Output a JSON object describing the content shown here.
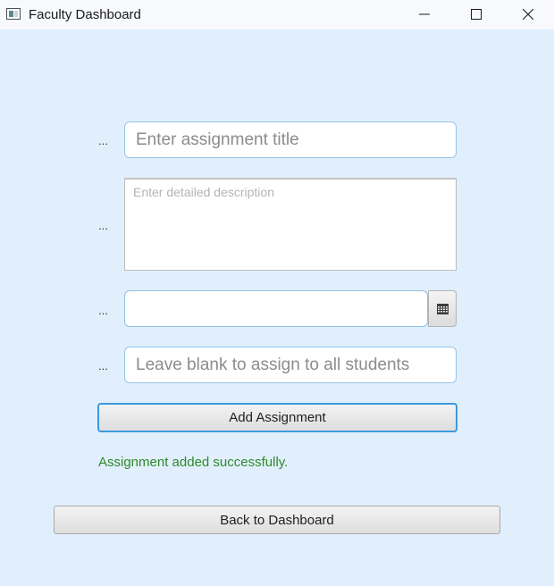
{
  "window": {
    "title": "Faculty Dashboard",
    "icons": [
      "app-icon",
      "minimize-icon",
      "maximize-icon",
      "close-icon"
    ]
  },
  "form": {
    "title_field": {
      "label": "...",
      "value": "",
      "placeholder": "Enter assignment title"
    },
    "description_field": {
      "label": "...",
      "value": "",
      "placeholder": "Enter detailed description"
    },
    "due_date_field": {
      "label": "...",
      "value": "",
      "icon": "calendar-icon"
    },
    "recipients_field": {
      "label": "...",
      "value": "",
      "placeholder": "Leave blank to assign to all students"
    },
    "submit_label": "Add Assignment"
  },
  "status": {
    "message": "Assignment added successfully.",
    "color": "#2d8a2d"
  },
  "footer": {
    "back_label": "Back to Dashboard"
  },
  "colors": {
    "background": "#e1effc",
    "focus_accent": "#3d9ade"
  }
}
